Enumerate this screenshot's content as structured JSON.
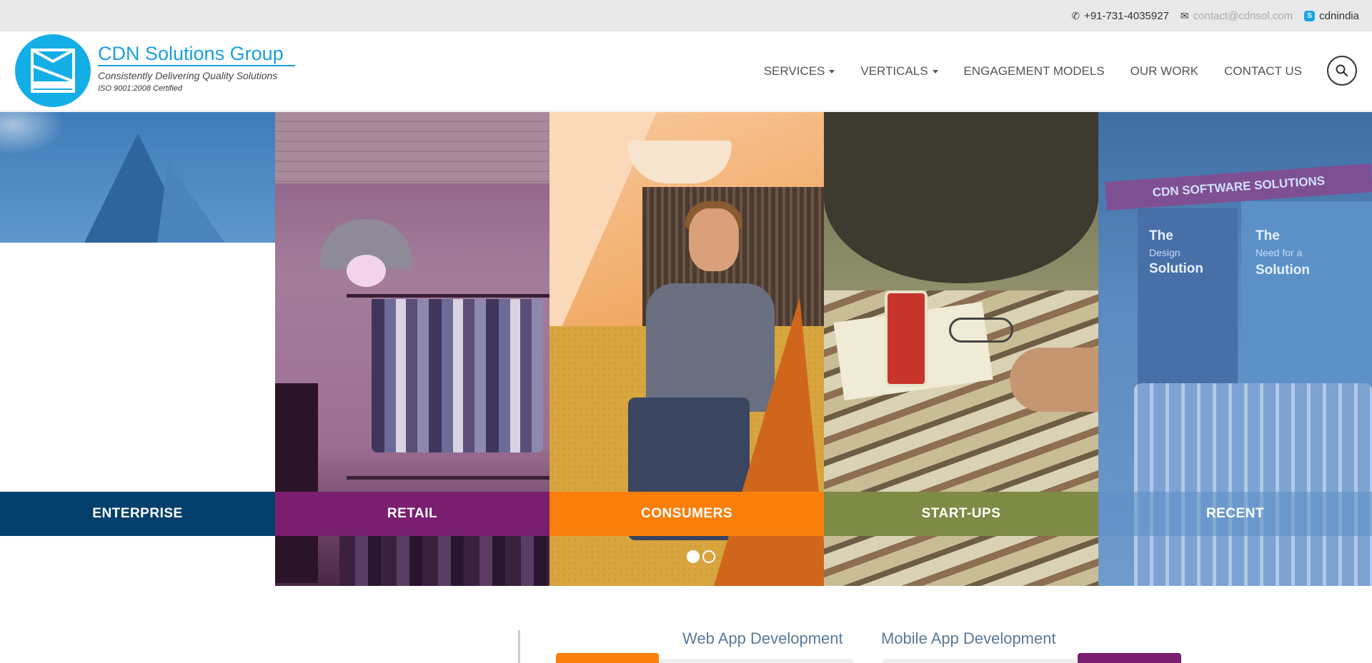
{
  "topbar": {
    "phone": "+91-731-4035927",
    "email": "contact@cdnsol.com",
    "skype": "cdnindia"
  },
  "brand": {
    "name": "CDN Solutions Group",
    "tagline": "Consistently Delivering Quality Solutions",
    "certification": "ISO 9001:2008 Certified"
  },
  "nav": {
    "items": [
      {
        "label": "SERVICES",
        "dropdown": true
      },
      {
        "label": "VERTICALS",
        "dropdown": true
      },
      {
        "label": "ENGAGEMENT MODELS",
        "dropdown": false
      },
      {
        "label": "OUR WORK",
        "dropdown": false
      },
      {
        "label": "CONTACT US",
        "dropdown": false
      }
    ]
  },
  "hero": {
    "panels": [
      {
        "label": "ENTERPRISE",
        "color": "#04406b"
      },
      {
        "label": "RETAIL",
        "color": "#7a1e70"
      },
      {
        "label": "CONSUMERS",
        "color": "#fa7f0a"
      },
      {
        "label": "START-UPS",
        "color": "#7d8b45"
      },
      {
        "label": "RECENT",
        "color": "#5d8fc6"
      }
    ],
    "recent_banner": "CDN SOFTWARE SOLUTIONS",
    "recent_wall1": {
      "title1": "The",
      "sub": "Design",
      "title2": "Solution"
    },
    "recent_wall2": {
      "title1": "The",
      "sub": "Need for a",
      "title2": "Solution"
    },
    "slider": {
      "count": 2,
      "active": 0
    }
  },
  "services_tabs": [
    {
      "label": "Web App Development",
      "accent": "#fa7f0a"
    },
    {
      "label": "Mobile App Development",
      "accent": "#7a1e70"
    }
  ],
  "colors": {
    "brand": "#14aee6",
    "topbar_bg": "#e9e9e9"
  }
}
